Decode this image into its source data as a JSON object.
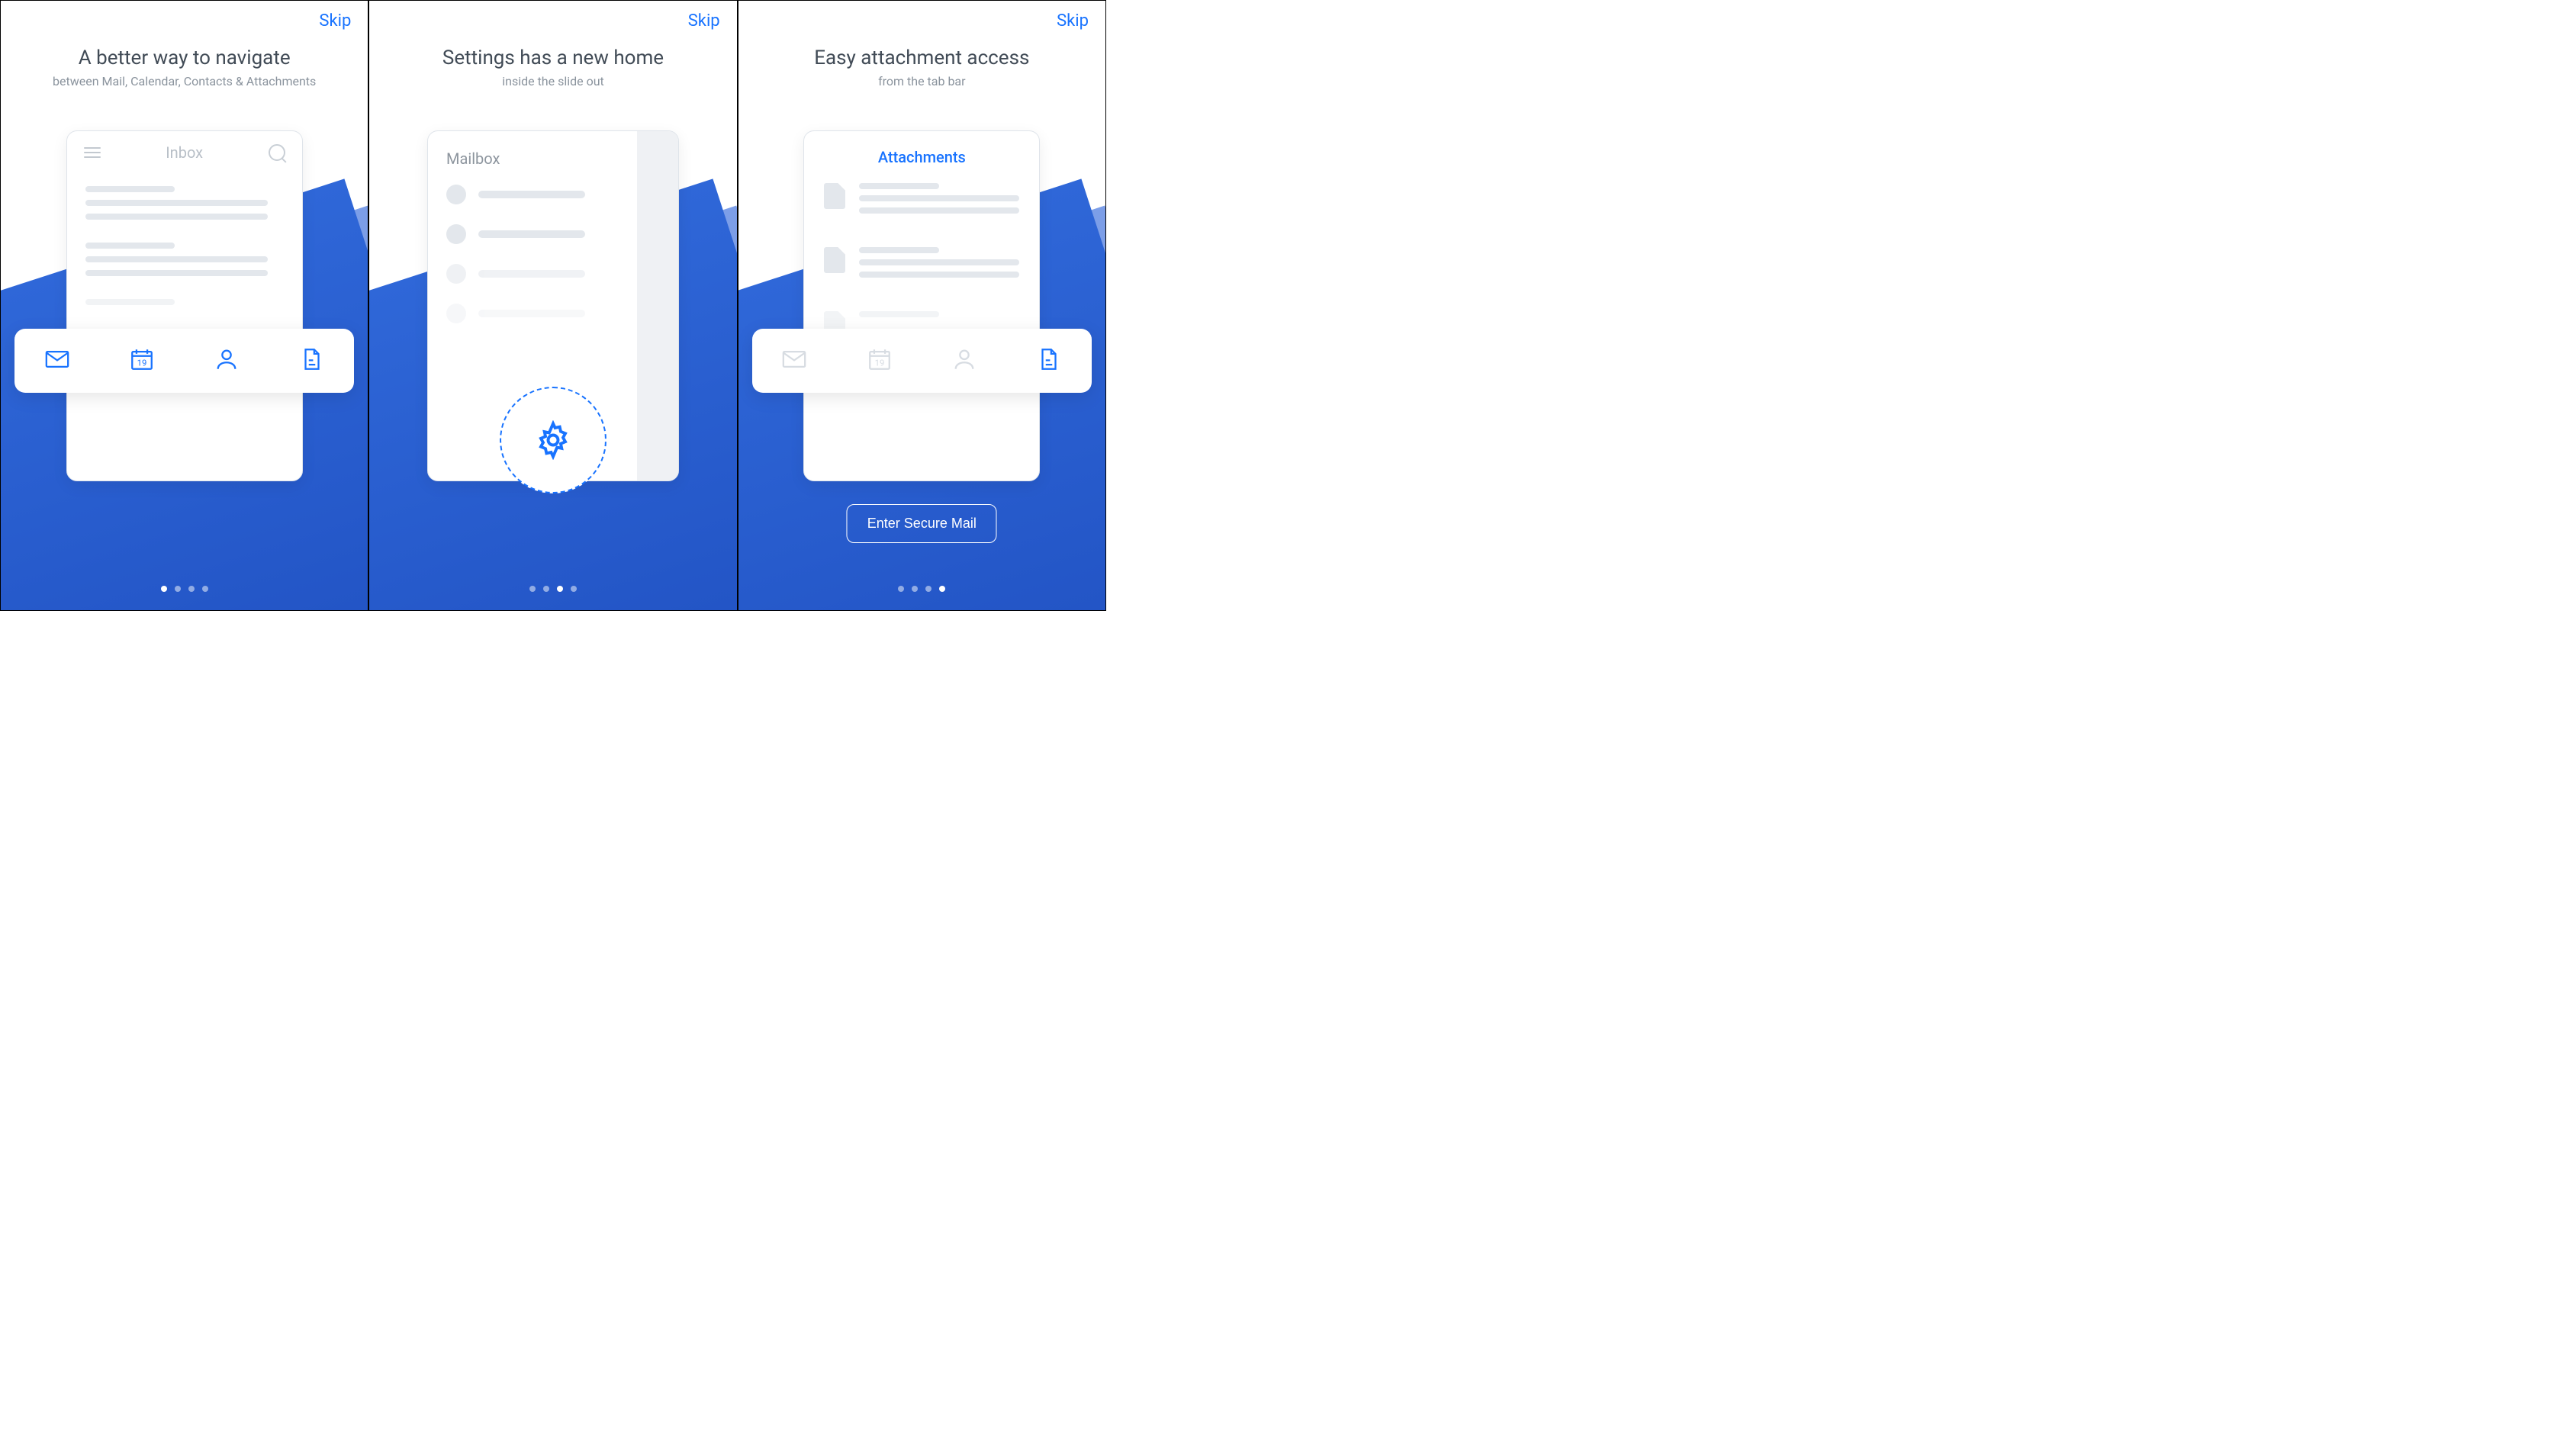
{
  "skip_label": "Skip",
  "panels": [
    {
      "title": "A better way to navigate",
      "subtitle": "between Mail, Calendar, Contacts & Attachments",
      "inbox_label": "Inbox",
      "calendar_day": "19",
      "tabs": [
        "mail-icon",
        "calendar-icon",
        "contact-icon",
        "file-icon"
      ],
      "pager": {
        "total": 4,
        "active_index": 0
      }
    },
    {
      "title": "Settings has a new home",
      "subtitle": "inside the slide out",
      "mailbox_label": "Mailbox",
      "highlight_icon": "gear-icon",
      "pager": {
        "total": 4,
        "active_index": 2
      }
    },
    {
      "title": "Easy attachment access",
      "subtitle": "from the tab bar",
      "attachments_label": "Attachments",
      "calendar_day": "19",
      "tabs": [
        "mail-icon",
        "calendar-icon",
        "contact-icon",
        "file-icon"
      ],
      "active_tab_index": 3,
      "cta_label": "Enter Secure Mail",
      "pager": {
        "total": 4,
        "active_index": 3
      }
    }
  ]
}
